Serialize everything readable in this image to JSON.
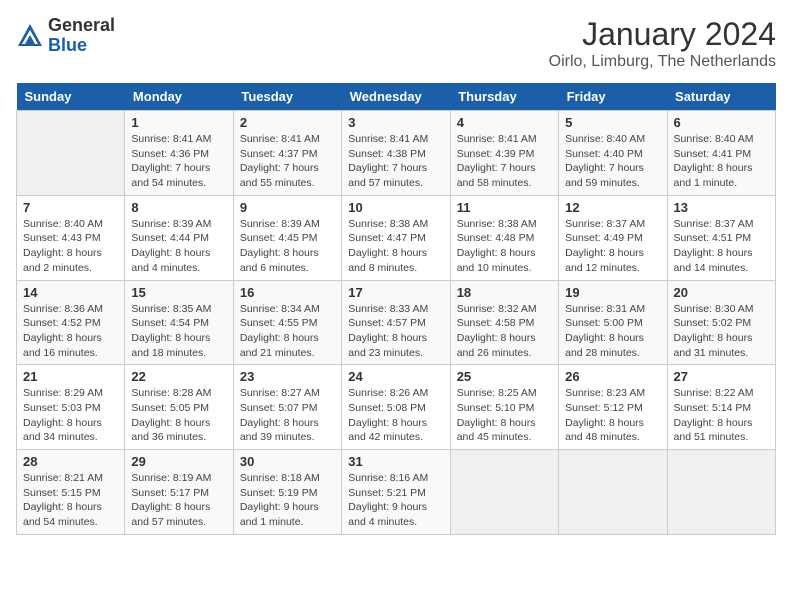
{
  "logo": {
    "general": "General",
    "blue": "Blue"
  },
  "title": "January 2024",
  "location": "Oirlo, Limburg, The Netherlands",
  "weekdays": [
    "Sunday",
    "Monday",
    "Tuesday",
    "Wednesday",
    "Thursday",
    "Friday",
    "Saturday"
  ],
  "weeks": [
    [
      {
        "day": "",
        "info": ""
      },
      {
        "day": "1",
        "info": "Sunrise: 8:41 AM\nSunset: 4:36 PM\nDaylight: 7 hours\nand 54 minutes."
      },
      {
        "day": "2",
        "info": "Sunrise: 8:41 AM\nSunset: 4:37 PM\nDaylight: 7 hours\nand 55 minutes."
      },
      {
        "day": "3",
        "info": "Sunrise: 8:41 AM\nSunset: 4:38 PM\nDaylight: 7 hours\nand 57 minutes."
      },
      {
        "day": "4",
        "info": "Sunrise: 8:41 AM\nSunset: 4:39 PM\nDaylight: 7 hours\nand 58 minutes."
      },
      {
        "day": "5",
        "info": "Sunrise: 8:40 AM\nSunset: 4:40 PM\nDaylight: 7 hours\nand 59 minutes."
      },
      {
        "day": "6",
        "info": "Sunrise: 8:40 AM\nSunset: 4:41 PM\nDaylight: 8 hours\nand 1 minute."
      }
    ],
    [
      {
        "day": "7",
        "info": "Sunrise: 8:40 AM\nSunset: 4:43 PM\nDaylight: 8 hours\nand 2 minutes."
      },
      {
        "day": "8",
        "info": "Sunrise: 8:39 AM\nSunset: 4:44 PM\nDaylight: 8 hours\nand 4 minutes."
      },
      {
        "day": "9",
        "info": "Sunrise: 8:39 AM\nSunset: 4:45 PM\nDaylight: 8 hours\nand 6 minutes."
      },
      {
        "day": "10",
        "info": "Sunrise: 8:38 AM\nSunset: 4:47 PM\nDaylight: 8 hours\nand 8 minutes."
      },
      {
        "day": "11",
        "info": "Sunrise: 8:38 AM\nSunset: 4:48 PM\nDaylight: 8 hours\nand 10 minutes."
      },
      {
        "day": "12",
        "info": "Sunrise: 8:37 AM\nSunset: 4:49 PM\nDaylight: 8 hours\nand 12 minutes."
      },
      {
        "day": "13",
        "info": "Sunrise: 8:37 AM\nSunset: 4:51 PM\nDaylight: 8 hours\nand 14 minutes."
      }
    ],
    [
      {
        "day": "14",
        "info": "Sunrise: 8:36 AM\nSunset: 4:52 PM\nDaylight: 8 hours\nand 16 minutes."
      },
      {
        "day": "15",
        "info": "Sunrise: 8:35 AM\nSunset: 4:54 PM\nDaylight: 8 hours\nand 18 minutes."
      },
      {
        "day": "16",
        "info": "Sunrise: 8:34 AM\nSunset: 4:55 PM\nDaylight: 8 hours\nand 21 minutes."
      },
      {
        "day": "17",
        "info": "Sunrise: 8:33 AM\nSunset: 4:57 PM\nDaylight: 8 hours\nand 23 minutes."
      },
      {
        "day": "18",
        "info": "Sunrise: 8:32 AM\nSunset: 4:58 PM\nDaylight: 8 hours\nand 26 minutes."
      },
      {
        "day": "19",
        "info": "Sunrise: 8:31 AM\nSunset: 5:00 PM\nDaylight: 8 hours\nand 28 minutes."
      },
      {
        "day": "20",
        "info": "Sunrise: 8:30 AM\nSunset: 5:02 PM\nDaylight: 8 hours\nand 31 minutes."
      }
    ],
    [
      {
        "day": "21",
        "info": "Sunrise: 8:29 AM\nSunset: 5:03 PM\nDaylight: 8 hours\nand 34 minutes."
      },
      {
        "day": "22",
        "info": "Sunrise: 8:28 AM\nSunset: 5:05 PM\nDaylight: 8 hours\nand 36 minutes."
      },
      {
        "day": "23",
        "info": "Sunrise: 8:27 AM\nSunset: 5:07 PM\nDaylight: 8 hours\nand 39 minutes."
      },
      {
        "day": "24",
        "info": "Sunrise: 8:26 AM\nSunset: 5:08 PM\nDaylight: 8 hours\nand 42 minutes."
      },
      {
        "day": "25",
        "info": "Sunrise: 8:25 AM\nSunset: 5:10 PM\nDaylight: 8 hours\nand 45 minutes."
      },
      {
        "day": "26",
        "info": "Sunrise: 8:23 AM\nSunset: 5:12 PM\nDaylight: 8 hours\nand 48 minutes."
      },
      {
        "day": "27",
        "info": "Sunrise: 8:22 AM\nSunset: 5:14 PM\nDaylight: 8 hours\nand 51 minutes."
      }
    ],
    [
      {
        "day": "28",
        "info": "Sunrise: 8:21 AM\nSunset: 5:15 PM\nDaylight: 8 hours\nand 54 minutes."
      },
      {
        "day": "29",
        "info": "Sunrise: 8:19 AM\nSunset: 5:17 PM\nDaylight: 8 hours\nand 57 minutes."
      },
      {
        "day": "30",
        "info": "Sunrise: 8:18 AM\nSunset: 5:19 PM\nDaylight: 9 hours\nand 1 minute."
      },
      {
        "day": "31",
        "info": "Sunrise: 8:16 AM\nSunset: 5:21 PM\nDaylight: 9 hours\nand 4 minutes."
      },
      {
        "day": "",
        "info": ""
      },
      {
        "day": "",
        "info": ""
      },
      {
        "day": "",
        "info": ""
      }
    ]
  ]
}
